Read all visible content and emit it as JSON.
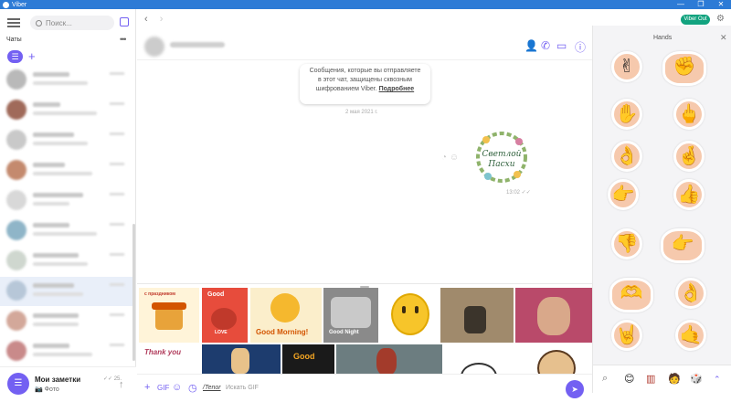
{
  "window": {
    "title": "Viber",
    "controls": [
      "—",
      "❐",
      "✕"
    ]
  },
  "left_pane": {
    "search_placeholder": "Поиск...",
    "chats_heading": "Чаты",
    "more": "•••",
    "filter_label": "☰",
    "add_label": "+",
    "pinned_chat": {
      "title": "Мои заметки",
      "subtitle": "📷 Фото",
      "time": "✓✓ 25.",
      "avatar_label": "☰"
    }
  },
  "center": {
    "back": "‹",
    "forward": "›",
    "encryption_notice_line1": "Сообщения, которые вы отправляете",
    "encryption_notice_line2": "в этот чат, защищены сквозным",
    "encryption_notice_line3": "шифрованием Viber.",
    "encryption_link": "Подробнее",
    "date_label": "2 мая 2021 г.",
    "sticker_text_1": "Светлой",
    "sticker_text_2": "Пасхи",
    "sticker_time": "13:02 ✓✓",
    "gifs": {
      "g1": "с праздником",
      "g2": "Good",
      "g3": "LOVE",
      "g4": "Good Morning!",
      "g5": "Good Night",
      "g6": "Thank you",
      "g7": "Good"
    },
    "input": {
      "tenor": "/Tenor",
      "placeholder": "Искать GIF"
    }
  },
  "topbar": {
    "viber_out": "Viber Out",
    "settings_icon": "⚙"
  },
  "sticker_pane": {
    "title": "Hands",
    "close": "✕"
  },
  "colors": {
    "accent": "#7360f2",
    "titlebar": "#2d7bd6",
    "viber_out": "#12a37f"
  }
}
